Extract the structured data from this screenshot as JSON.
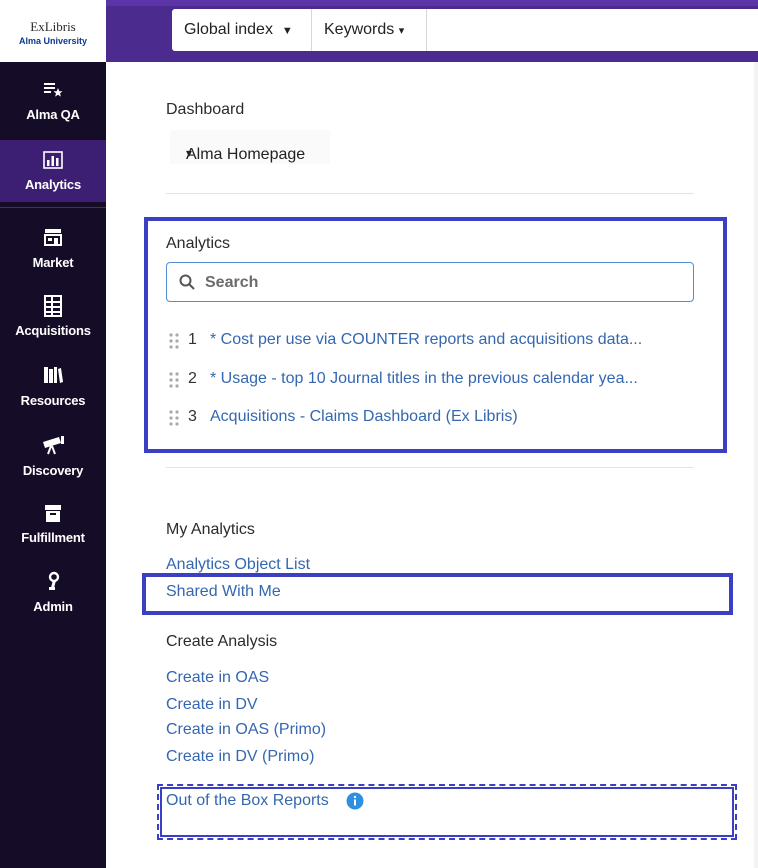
{
  "logo": {
    "name": "ExLibris",
    "institution": "Alma University"
  },
  "nav": [
    {
      "icon": "list-star-icon",
      "label": "Alma QA",
      "active": false
    },
    {
      "icon": "bar-chart-icon",
      "label": "Analytics",
      "active": true
    },
    {
      "icon": "storefront-icon",
      "label": "Market",
      "active": false
    },
    {
      "icon": "ledger-icon",
      "label": "Acquisitions",
      "active": false
    },
    {
      "icon": "books-icon",
      "label": "Resources",
      "active": false
    },
    {
      "icon": "telescope-icon",
      "label": "Discovery",
      "active": false
    },
    {
      "icon": "archive-box-icon",
      "label": "Fulfillment",
      "active": false
    },
    {
      "icon": "admin-wrench-icon",
      "label": "Admin",
      "active": false
    }
  ],
  "search_bar": {
    "scope": "Global index",
    "field": "Keywords"
  },
  "dashboard": {
    "heading": "Dashboard",
    "selected": "Alma Homepage"
  },
  "analytics": {
    "heading": "Analytics",
    "search_placeholder": "Search",
    "items": [
      {
        "num": "1",
        "label": "* Cost per use via COUNTER reports and acquisitions data..."
      },
      {
        "num": "2",
        "label": "* Usage - top 10 Journal titles in the previous calendar yea..."
      },
      {
        "num": "3",
        "label": "Acquisitions - Claims Dashboard (Ex Libris)"
      }
    ]
  },
  "my_analytics": {
    "heading": "My Analytics",
    "links": [
      "Analytics Object List",
      "Shared With Me"
    ]
  },
  "create_analysis": {
    "heading": "Create Analysis",
    "links": [
      "Create in OAS",
      "Create in DV",
      "Create in OAS (Primo)",
      "Create in DV (Primo)"
    ]
  },
  "ootb": {
    "label": "Out of the Box Reports",
    "icon": "info-icon"
  },
  "colors": {
    "rail": "#150c28",
    "active": "#3c1f73",
    "topbar": "#4b2b8e",
    "link": "#3467b0",
    "highlight": "#3a3fc4"
  }
}
